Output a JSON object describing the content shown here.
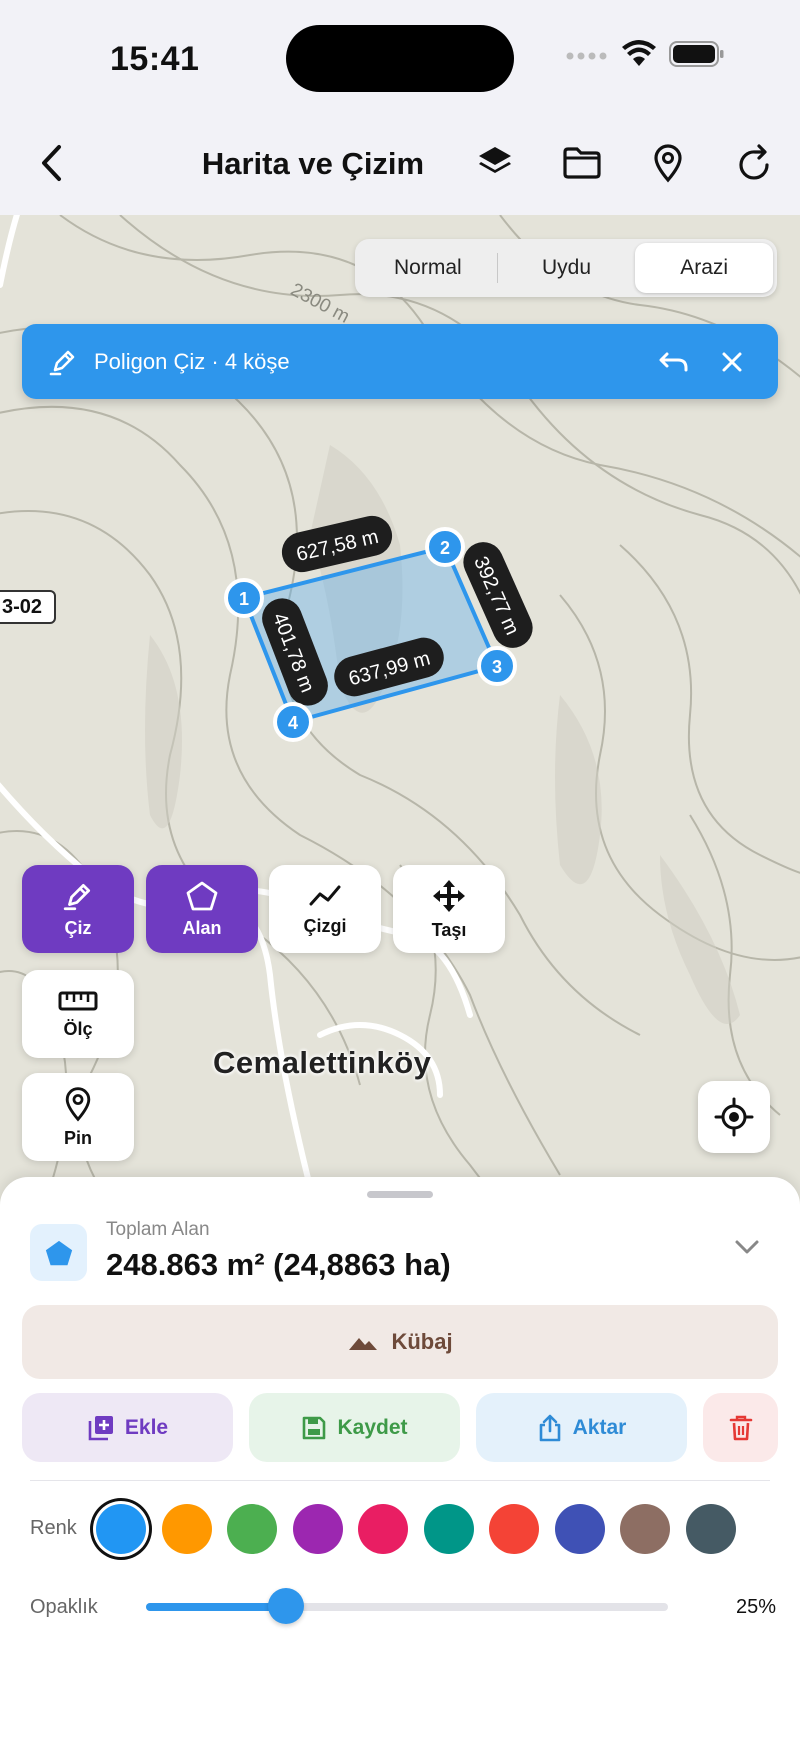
{
  "status_bar": {
    "time": "15:41"
  },
  "nav": {
    "title": "Harita ve Çizim"
  },
  "map_type": {
    "options": [
      "Normal",
      "Uydu",
      "Arazi"
    ],
    "selected": "Arazi"
  },
  "banner": {
    "text": "Poligon Çiz · 4 köşe"
  },
  "map": {
    "road_label": "3-02",
    "contour_label": "2300 m",
    "place_label": "Cemalettinköy",
    "vertices": [
      "1",
      "2",
      "3",
      "4"
    ],
    "edge_labels": [
      "627,58 m",
      "392,77 m",
      "637,99 m",
      "401,78 m"
    ]
  },
  "tools": {
    "draw": "Çiz",
    "area": "Alan",
    "line": "Çizgi",
    "move": "Taşı",
    "measure": "Ölç",
    "pin": "Pin"
  },
  "sheet": {
    "caption": "Toplam Alan",
    "value": "248.863 m² (24,8863 ha)",
    "kubaj": "Kübaj",
    "add": "Ekle",
    "save": "Kaydet",
    "export": "Aktar",
    "color_label": "Renk",
    "opacity_label": "Opaklık",
    "opacity_value": "25%",
    "opacity": 0.25,
    "colors": [
      "#2196F3",
      "#FF9800",
      "#4CAF50",
      "#9C27B0",
      "#E91E63",
      "#009688",
      "#F44336",
      "#3F51B5",
      "#8D6E63",
      "#455A64"
    ],
    "selected_color": "#2196F3"
  },
  "colors": {
    "accent": "#2E96EC",
    "tool_active": "#6F3BC1",
    "delete": "#E53935"
  }
}
